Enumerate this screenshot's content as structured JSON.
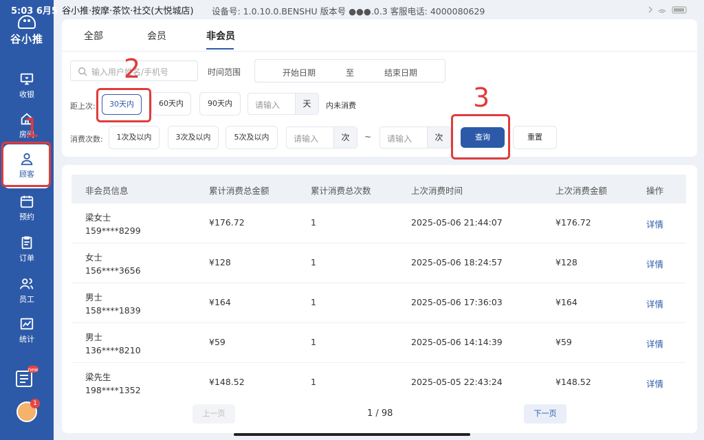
{
  "status": {
    "time": "5:03",
    "date": "6月5",
    "title": "谷小推·按摩·茶饮·社交(大悦城店)",
    "device_info": "设备号: 1.0.10.0.BENSHU   版本号 ●●●.0.3   客服电话: 4000080629"
  },
  "sidebar": {
    "logo_text": "谷小推",
    "items": [
      {
        "label": "收银",
        "icon": "monitor-icon"
      },
      {
        "label": "房间",
        "icon": "house-icon"
      },
      {
        "label": "顾客",
        "icon": "user-icon"
      },
      {
        "label": "预约",
        "icon": "calendar-icon"
      },
      {
        "label": "订单",
        "icon": "clipboard-icon"
      },
      {
        "label": "员工",
        "icon": "users-icon"
      },
      {
        "label": "统计",
        "icon": "chart-icon"
      }
    ],
    "news_label": "new",
    "avatar_badge": "1"
  },
  "tabs": [
    "全部",
    "会员",
    "非会员"
  ],
  "filters": {
    "search_placeholder": "输入用户姓名/手机号",
    "time_range_label": "时间范围",
    "start_date": "开始日期",
    "to": "至",
    "end_date": "结束日期",
    "last_visit_label": "距上次:",
    "day_options": [
      "30天内",
      "60天内",
      "90天内"
    ],
    "day_input_placeholder": "请输入",
    "day_unit": "天",
    "no_consume_suffix": "内未消费",
    "count_label": "消费次数:",
    "count_options": [
      "1次及以内",
      "3次及以内",
      "5次及以内"
    ],
    "count_input_placeholder": "请输入",
    "count_unit": "次",
    "tilde": "~",
    "query": "查询",
    "reset": "重置"
  },
  "annotations": [
    "1",
    "2",
    "3"
  ],
  "table": {
    "headers": [
      "非会员信息",
      "累计消费总金额",
      "累计消费总次数",
      "上次消费时间",
      "上次消费金额",
      "操作"
    ],
    "rows": [
      {
        "name": "梁女士",
        "phone": "159****8299",
        "total": "¥176.72",
        "count": "1",
        "last_time": "2025-05-06 21:44:07",
        "last_amount": "¥176.72",
        "action": "详情"
      },
      {
        "name": "女士",
        "phone": "156****3656",
        "total": "¥128",
        "count": "1",
        "last_time": "2025-05-06 18:24:57",
        "last_amount": "¥128",
        "action": "详情"
      },
      {
        "name": "男士",
        "phone": "158****1839",
        "total": "¥164",
        "count": "1",
        "last_time": "2025-05-06 17:36:03",
        "last_amount": "¥164",
        "action": "详情"
      },
      {
        "name": "男士",
        "phone": "136****8210",
        "total": "¥59",
        "count": "1",
        "last_time": "2025-05-06 14:14:39",
        "last_amount": "¥59",
        "action": "详情"
      },
      {
        "name": "梁先生",
        "phone": "198****1352",
        "total": "¥148.52",
        "count": "1",
        "last_time": "2025-05-05 22:43:24",
        "last_amount": "¥148.52",
        "action": "详情"
      }
    ]
  },
  "pager": {
    "prev": "上一页",
    "info": "1 / 98",
    "next": "下一页"
  }
}
